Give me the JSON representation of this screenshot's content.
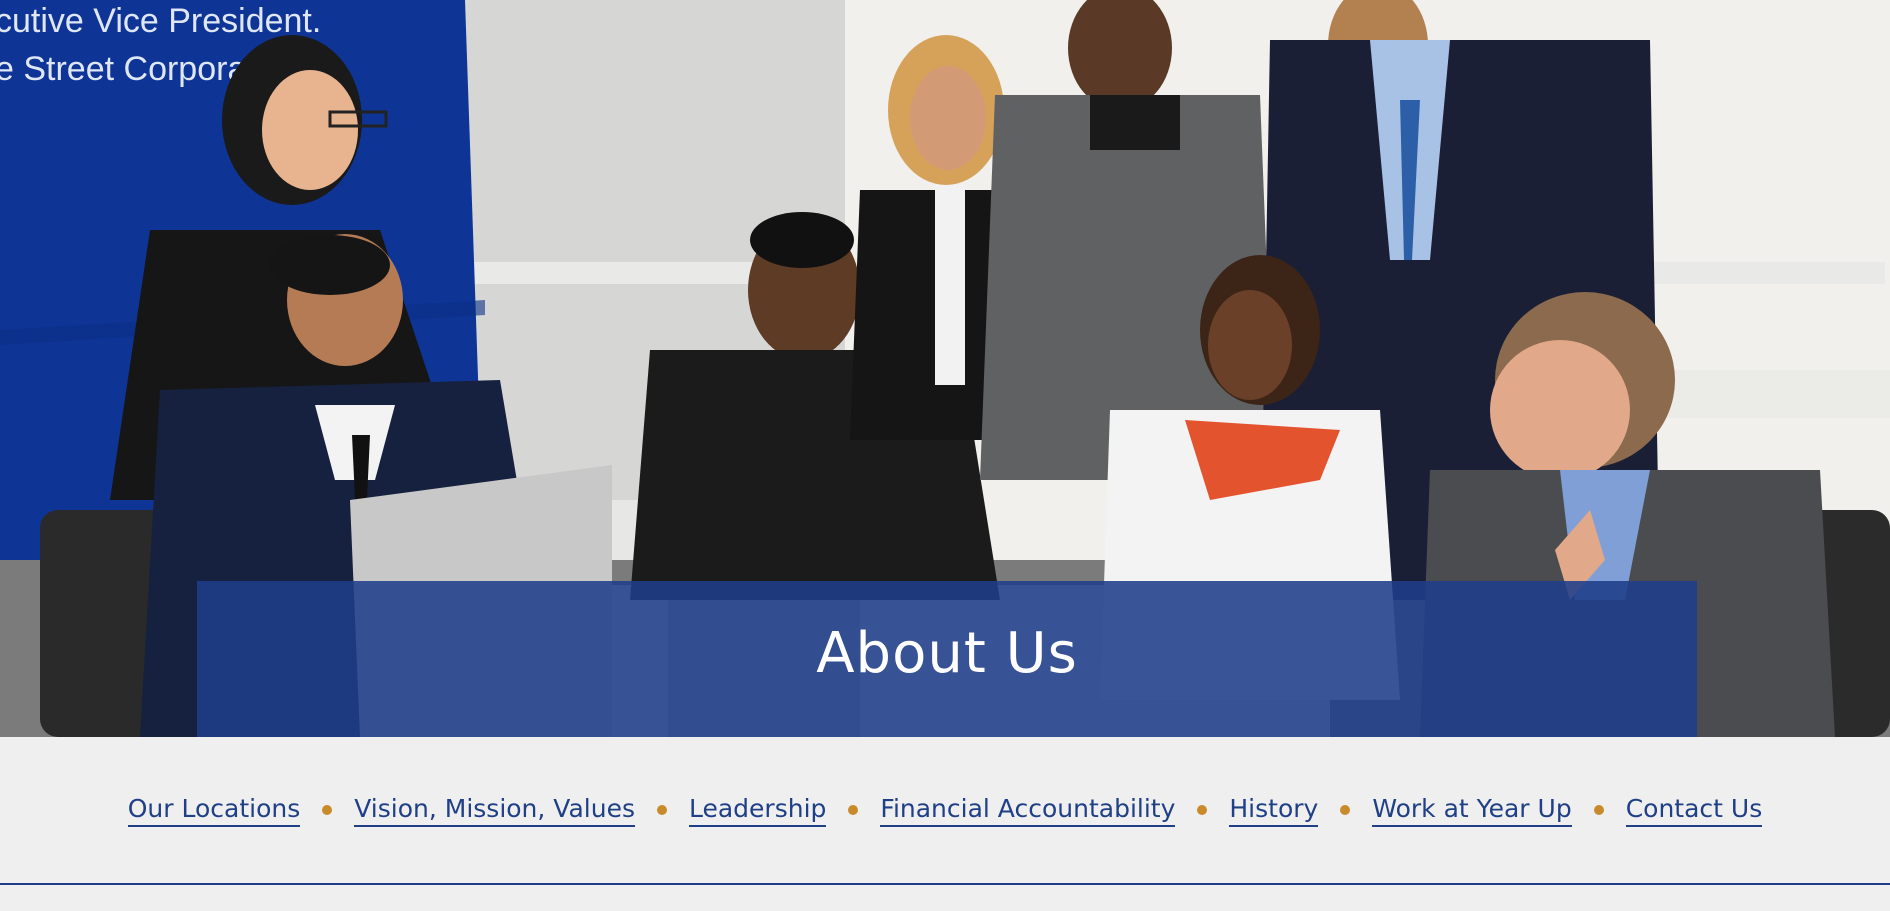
{
  "hero": {
    "title": "About Us",
    "backdrop_text": [
      "cutive Vice President.",
      "e Street Corporat"
    ],
    "colors": {
      "band": "#1f3e8a",
      "wall_panel": "#0e3596"
    }
  },
  "subnav": {
    "separator_color": "#c98a2b",
    "link_color": "#1f3f86",
    "items": [
      {
        "label": "Our Locations"
      },
      {
        "label": "Vision, Mission, Values"
      },
      {
        "label": "Leadership"
      },
      {
        "label": "Financial Accountability"
      },
      {
        "label": "History"
      },
      {
        "label": "Work at Year Up"
      },
      {
        "label": "Contact Us"
      }
    ]
  }
}
